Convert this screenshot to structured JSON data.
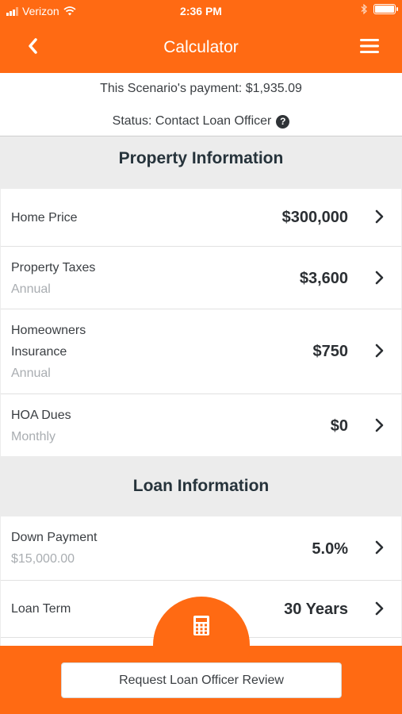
{
  "status_bar": {
    "carrier": "Verizon",
    "time": "2:36 PM"
  },
  "nav": {
    "title": "Calculator"
  },
  "summary": {
    "payment_text": "This Scenario's payment: $1,935.09",
    "status_text": "Status: Contact Loan Officer",
    "help_glyph": "?"
  },
  "property": {
    "heading": "Property Information",
    "rows": [
      {
        "label": "Home Price",
        "value": "$300,000"
      },
      {
        "label": "Property Taxes",
        "sub": "Annual",
        "value": "$3,600"
      },
      {
        "label": "Homeowners",
        "label2": "Insurance",
        "sub": "Annual",
        "value": "$750"
      },
      {
        "label": "HOA Dues",
        "sub": "Monthly",
        "value": "$0"
      }
    ]
  },
  "loan": {
    "heading": "Loan Information",
    "rows": [
      {
        "label": "Down Payment",
        "sub": "$15,000.00",
        "value": "5.0%"
      },
      {
        "label": "Loan Term",
        "value": "30 Years"
      }
    ]
  },
  "footer": {
    "button_label": "Request Loan Officer Review"
  },
  "icons": [
    "signal-icon",
    "wifi-icon",
    "bluetooth-icon",
    "battery-icon",
    "back-icon",
    "menu-icon",
    "help-icon",
    "chevron-right-icon",
    "calculator-icon"
  ],
  "colors": {
    "brand_orange": "#ff6a13",
    "text_dark": "#2b2f33",
    "text_muted": "#a9adb1",
    "background": "#ececec"
  }
}
